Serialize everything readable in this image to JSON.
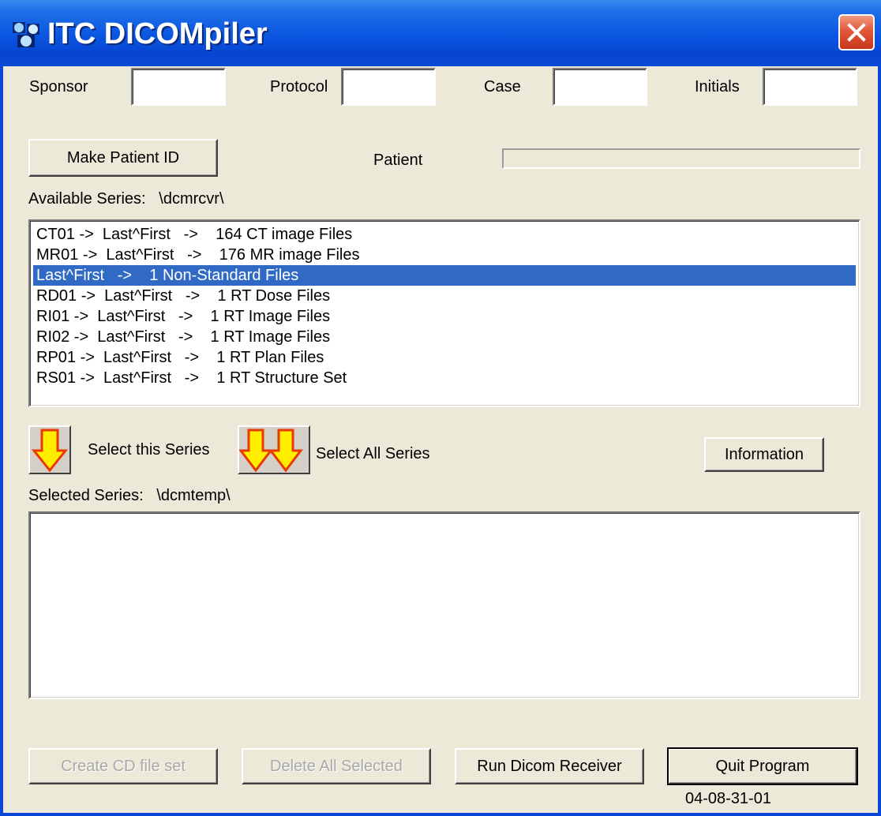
{
  "window": {
    "title": "ITC DICOMpiler"
  },
  "fields": {
    "sponsor_label": "Sponsor",
    "protocol_label": "Protocol",
    "case_label": "Case",
    "initials_label": "Initials",
    "sponsor_value": "",
    "protocol_value": "",
    "case_value": "",
    "initials_value": ""
  },
  "patient": {
    "make_id_button": "Make Patient ID",
    "label": "Patient",
    "progress": 0
  },
  "available": {
    "label": "Available Series:",
    "path": "\\dcmrcvr\\",
    "items": [
      "CT01 ->  Last^First   ->    164 CT image Files",
      "MR01 ->  Last^First   ->    176 MR image Files",
      "Last^First   ->    1 Non-Standard Files",
      "RD01 ->  Last^First   ->    1 RT Dose Files",
      "RI01 ->  Last^First   ->    1 RT Image Files",
      "RI02 ->  Last^First   ->    1 RT Image Files",
      "RP01 ->  Last^First   ->    1 RT Plan Files",
      "RS01 ->  Last^First   ->    1 RT Structure Set"
    ],
    "selected_index": 2
  },
  "actions": {
    "select_this": "Select this Series",
    "select_all": "Select All Series",
    "information": "Information"
  },
  "selected": {
    "label": "Selected Series:",
    "path": "\\dcmtemp\\",
    "items": []
  },
  "footer": {
    "create_cd": "Create CD file set",
    "delete_all": "Delete All Selected",
    "run_receiver": "Run Dicom Receiver",
    "quit": "Quit Program",
    "version": "04-08-31-01"
  },
  "colors": {
    "titlebar": "#0a55df",
    "window_bg": "#ece9d8",
    "selection": "#316ac5",
    "close_button": "#e2573a",
    "arrow_fill": "#ffee00",
    "arrow_outline": "#e83a00"
  },
  "icons": {
    "app": "app-icon",
    "close": "close-icon",
    "select_one": "single-down-arrow-icon",
    "select_all": "double-down-arrow-icon"
  }
}
